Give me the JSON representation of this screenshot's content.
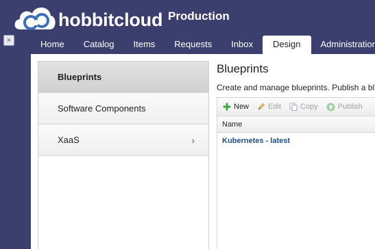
{
  "header": {
    "brand": "hobbitcloud",
    "environment": "Production"
  },
  "nav": {
    "tabs": [
      {
        "label": "Home",
        "active": false
      },
      {
        "label": "Catalog",
        "active": false
      },
      {
        "label": "Items",
        "active": false
      },
      {
        "label": "Requests",
        "active": false
      },
      {
        "label": "Inbox",
        "active": false
      },
      {
        "label": "Design",
        "active": true
      },
      {
        "label": "Administration",
        "active": false
      }
    ],
    "collapse_glyph": "»"
  },
  "sidebar": {
    "items": [
      {
        "label": "Blueprints",
        "selected": true
      },
      {
        "label": "Software Components",
        "selected": false
      },
      {
        "label": "XaaS",
        "selected": false,
        "chevron": "›"
      }
    ]
  },
  "content": {
    "title": "Blueprints",
    "description": "Create and manage blueprints. Publish a bl",
    "toolbar": {
      "new_label": "New",
      "edit_label": "Edit",
      "copy_label": "Copy",
      "publish_label": "Publish"
    },
    "grid": {
      "columns": [
        "Name"
      ],
      "rows": [
        {
          "name": "Kubernetes - latest"
        }
      ]
    }
  },
  "colors": {
    "background": "#3b3f6e",
    "link": "#1f4e8c",
    "new_icon": "#3da83d",
    "disabled": "#a0a0a0"
  }
}
